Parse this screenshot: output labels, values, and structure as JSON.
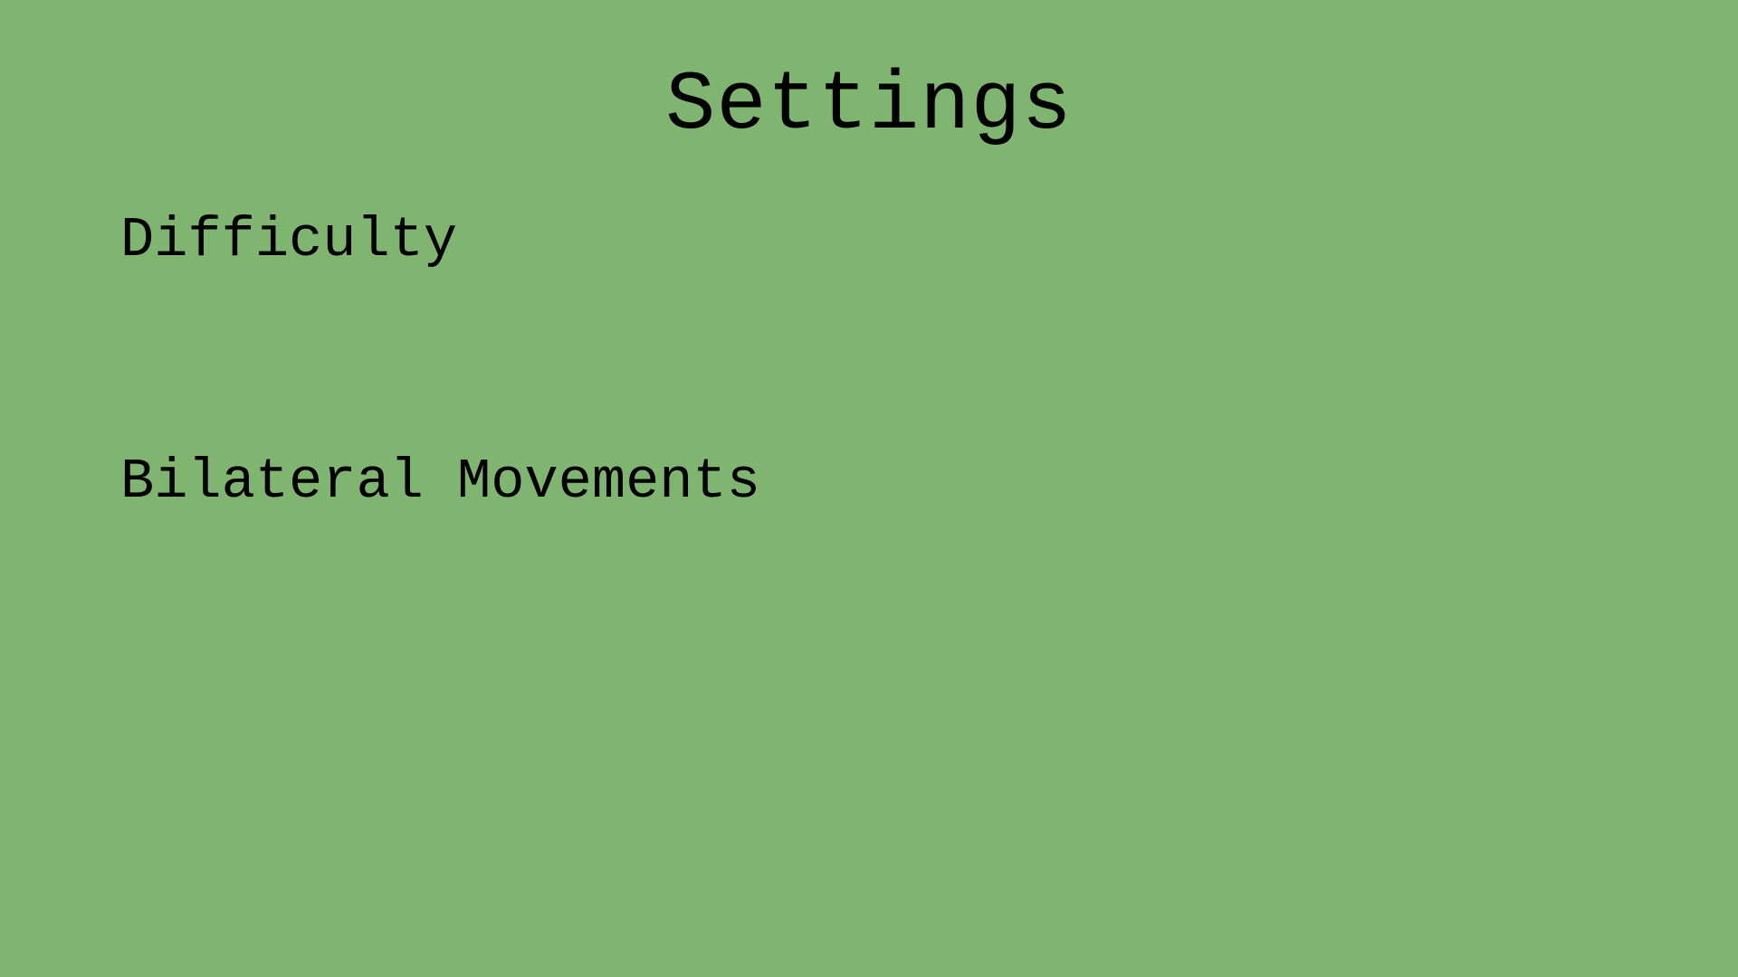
{
  "theme": {
    "background": "#7fb471",
    "text": "#000000"
  },
  "screen": {
    "title": "Settings"
  },
  "settings": {
    "items": [
      {
        "label": "Difficulty"
      },
      {
        "label": "Bilateral Movements"
      }
    ]
  }
}
